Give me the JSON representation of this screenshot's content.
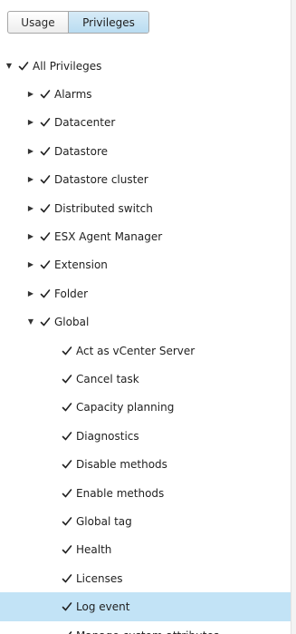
{
  "tabs": {
    "usage_label": "Usage",
    "privileges_label": "Privileges",
    "selected": "Privileges"
  },
  "tree": {
    "root": {
      "label": "All Privileges",
      "expanded": true,
      "checked": true
    },
    "categories": [
      {
        "label": "Alarms",
        "expanded": false
      },
      {
        "label": "Datacenter",
        "expanded": false
      },
      {
        "label": "Datastore",
        "expanded": false
      },
      {
        "label": "Datastore cluster",
        "expanded": false
      },
      {
        "label": "Distributed switch",
        "expanded": false
      },
      {
        "label": "ESX Agent Manager",
        "expanded": false
      },
      {
        "label": "Extension",
        "expanded": false
      },
      {
        "label": "Folder",
        "expanded": false
      },
      {
        "label": "Global",
        "expanded": true
      }
    ],
    "global_children": [
      {
        "label": "Act as vCenter Server"
      },
      {
        "label": "Cancel task"
      },
      {
        "label": "Capacity planning"
      },
      {
        "label": "Diagnostics"
      },
      {
        "label": "Disable methods"
      },
      {
        "label": "Enable methods"
      },
      {
        "label": "Global tag"
      },
      {
        "label": "Health"
      },
      {
        "label": "Licenses"
      },
      {
        "label": "Log event",
        "selected": true
      },
      {
        "label": "Manage custom attributes"
      }
    ]
  },
  "icons": {
    "expanded": "caret-down-icon",
    "collapsed": "caret-right-icon",
    "check": "checkmark-icon"
  },
  "colors": {
    "selected_tab_bg": "#c4e2f4",
    "selected_row_bg": "#c2e3f6"
  }
}
